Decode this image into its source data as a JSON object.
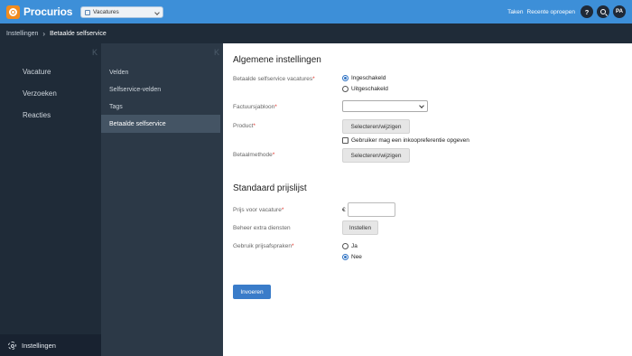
{
  "app": {
    "name": "Procurios"
  },
  "module_switcher": {
    "value": "Vacatures"
  },
  "topnav": {
    "tasks": "Taken",
    "recent": "Recente oproepen",
    "help": "?",
    "avatar": "PA"
  },
  "breadcrumb": {
    "root": "Instellingen",
    "separator": "›",
    "current": "Betaalde selfservice"
  },
  "sidebar": {
    "collapse": "K",
    "items": [
      {
        "label": "Vacature"
      },
      {
        "label": "Verzoeken"
      },
      {
        "label": "Reacties"
      }
    ],
    "footer": {
      "label": "Instellingen"
    }
  },
  "subnav": {
    "collapse": "K",
    "items": [
      {
        "label": "Velden",
        "active": false
      },
      {
        "label": "Selfservice-velden",
        "active": false
      },
      {
        "label": "Tags",
        "active": false
      },
      {
        "label": "Betaalde selfservice",
        "active": true
      }
    ]
  },
  "general": {
    "title": "Algemene instellingen",
    "paid_selfservice": {
      "label": "Betaalde selfservice vacatures",
      "options": [
        {
          "label": "Ingeschakeld",
          "checked": true
        },
        {
          "label": "Uitgeschakeld",
          "checked": false
        }
      ]
    },
    "invoice_template": {
      "label": "Factuursjabloon",
      "value": ""
    },
    "product": {
      "label": "Product",
      "button": "Selecteren/wijzigen"
    },
    "purchase_pref": {
      "label": "Gebruiker mag een inkoopreferentie opgeven",
      "checked": false
    },
    "payment_method": {
      "label": "Betaalmethode",
      "button": "Selecteren/wijzigen"
    }
  },
  "pricelist": {
    "title": "Standaard prijslijst",
    "price": {
      "label": "Prijs voor vacature",
      "currency": "€",
      "value": ""
    },
    "extra_services": {
      "label": "Beheer extra diensten",
      "button": "Instellen"
    },
    "price_agreements": {
      "label": "Gebruik prijsafspraken",
      "options": [
        {
          "label": "Ja",
          "checked": false
        },
        {
          "label": "Nee",
          "checked": true
        }
      ]
    }
  },
  "required_mark": "*",
  "submit": {
    "label": "Invoeren"
  },
  "colors": {
    "topbar": "#3d8fd8",
    "sidebar": "#1f2b38",
    "subnav": "#2c3947",
    "accent": "#3a7cc9",
    "logo": "#f28c1e",
    "required": "#e0352b"
  }
}
